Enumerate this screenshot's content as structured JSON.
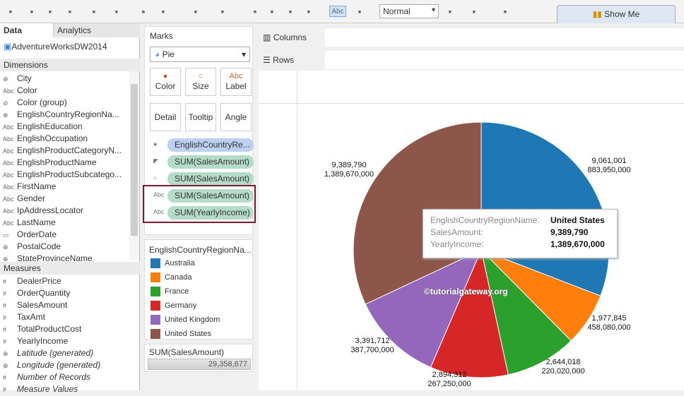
{
  "toolbar": {
    "mark_size": "Normal",
    "show_me": "Show Me",
    "icons": [
      "tableau-logo-icon",
      "back-icon",
      "forward-icon",
      "save-icon",
      "new-datasource-icon",
      "new-worksheet-icon",
      "duplicate-icon",
      "clear-icon",
      "swap-icon",
      "refresh-icon",
      "group-icon",
      "sort-asc-icon",
      "sort-desc-icon",
      "highlight-icon",
      "show-labels-icon",
      "chart-type-icon",
      "fix-axes-icon",
      "pen-icon",
      "presentation-icon"
    ]
  },
  "left": {
    "tabs": [
      "Data",
      "Analytics"
    ],
    "datasource": "AdventureWorksDW2014",
    "dimensions_title": "Dimensions",
    "measures_title": "Measures",
    "dimensions": [
      {
        "icon": "globe",
        "label": "City"
      },
      {
        "icon": "Abc",
        "label": "Color"
      },
      {
        "icon": "clip",
        "label": "Color (group)"
      },
      {
        "icon": "globe",
        "label": "EnglishCountryRegionNa..."
      },
      {
        "icon": "Abc",
        "label": "EnglishEducation"
      },
      {
        "icon": "Abc",
        "label": "EnglishOccupation"
      },
      {
        "icon": "Abc",
        "label": "EnglishProductCategoryN..."
      },
      {
        "icon": "Abc",
        "label": "EnglishProductName"
      },
      {
        "icon": "Abc",
        "label": "EnglishProductSubcatego..."
      },
      {
        "icon": "Abc",
        "label": "FirstName"
      },
      {
        "icon": "Abc",
        "label": "Gender"
      },
      {
        "icon": "Abc",
        "label": "IpAddressLocator"
      },
      {
        "icon": "Abc",
        "label": "LastName"
      },
      {
        "icon": "date",
        "label": "OrderDate"
      },
      {
        "icon": "globe",
        "label": "PostalCode"
      },
      {
        "icon": "globe",
        "label": "StateProvinceName"
      }
    ],
    "measures": [
      {
        "icon": "#",
        "label": "DealerPrice"
      },
      {
        "icon": "#",
        "label": "OrderQuantity"
      },
      {
        "icon": "#",
        "label": "SalesAmount"
      },
      {
        "icon": "#",
        "label": "TaxAmt"
      },
      {
        "icon": "#",
        "label": "TotalProductCost"
      },
      {
        "icon": "#",
        "label": "YearlyIncome"
      },
      {
        "icon": "globe",
        "label": "Latitude (generated)",
        "italic": true
      },
      {
        "icon": "globe",
        "label": "Longitude (generated)",
        "italic": true
      },
      {
        "icon": "#",
        "label": "Number of Records",
        "italic": true
      },
      {
        "icon": "#",
        "label": "Measure Values",
        "italic": true
      }
    ]
  },
  "marks": {
    "title": "Marks",
    "type": "Pie",
    "buttons": [
      "Color",
      "Size",
      "Label",
      "Detail",
      "Tooltip",
      "Angle"
    ],
    "pills": [
      {
        "icon": "color",
        "label": "EnglishCountryRe..."
      },
      {
        "icon": "angle",
        "label": "SUM(SalesAmount)"
      },
      {
        "icon": "size",
        "label": "SUM(SalesAmount)"
      },
      {
        "icon": "label",
        "label": "SUM(SalesAmount)"
      },
      {
        "icon": "label",
        "label": "SUM(YearlyIncome)"
      }
    ],
    "highlight_color": "#7a1c2e"
  },
  "legend": {
    "title": "EnglishCountryRegionNa...",
    "items": [
      {
        "label": "Australia",
        "color": "#1f77b4"
      },
      {
        "label": "Canada",
        "color": "#ff7f0e"
      },
      {
        "label": "France",
        "color": "#2ca02c"
      },
      {
        "label": "Germany",
        "color": "#d62728"
      },
      {
        "label": "United Kingdom",
        "color": "#9467bd"
      },
      {
        "label": "United States",
        "color": "#8c564b"
      }
    ]
  },
  "size_legend": {
    "title": "SUM(SalesAmount)",
    "value": "29,358,677"
  },
  "shelves": {
    "columns": "Columns",
    "rows": "Rows"
  },
  "chart_data": {
    "type": "pie",
    "categories": [
      "Australia",
      "Canada",
      "France",
      "Germany",
      "United Kingdom",
      "United States"
    ],
    "series": [
      {
        "name": "SUM(SalesAmount)",
        "values": [
          9061001,
          1977845,
          2644018,
          2894312,
          3391712,
          9389790
        ]
      },
      {
        "name": "SUM(YearlyIncome)",
        "values": [
          883950000,
          458080000,
          220020000,
          267250000,
          387700000,
          1389670000
        ]
      }
    ],
    "labels": [
      [
        "9,061,001",
        "883,950,000"
      ],
      [
        "1,977,845",
        "458,080,000"
      ],
      [
        "2,644,018",
        "220,020,000"
      ],
      [
        "2,894,312",
        "267,250,000"
      ],
      [
        "3,391,712",
        "387,700,000"
      ],
      [
        "9,389,790",
        "1,389,670,000"
      ]
    ],
    "colors": [
      "#1f77b4",
      "#ff7f0e",
      "#2ca02c",
      "#d62728",
      "#9467bd",
      "#8c564b"
    ]
  },
  "watermark": "©tutorialgateway.org",
  "tooltip": {
    "rows": [
      {
        "key": "EnglishCountryRegionName:",
        "value": "United States"
      },
      {
        "key": "SalesAmount:",
        "value": "9,389,790"
      },
      {
        "key": "YearlyIncome:",
        "value": "1,389,670,000"
      }
    ]
  }
}
